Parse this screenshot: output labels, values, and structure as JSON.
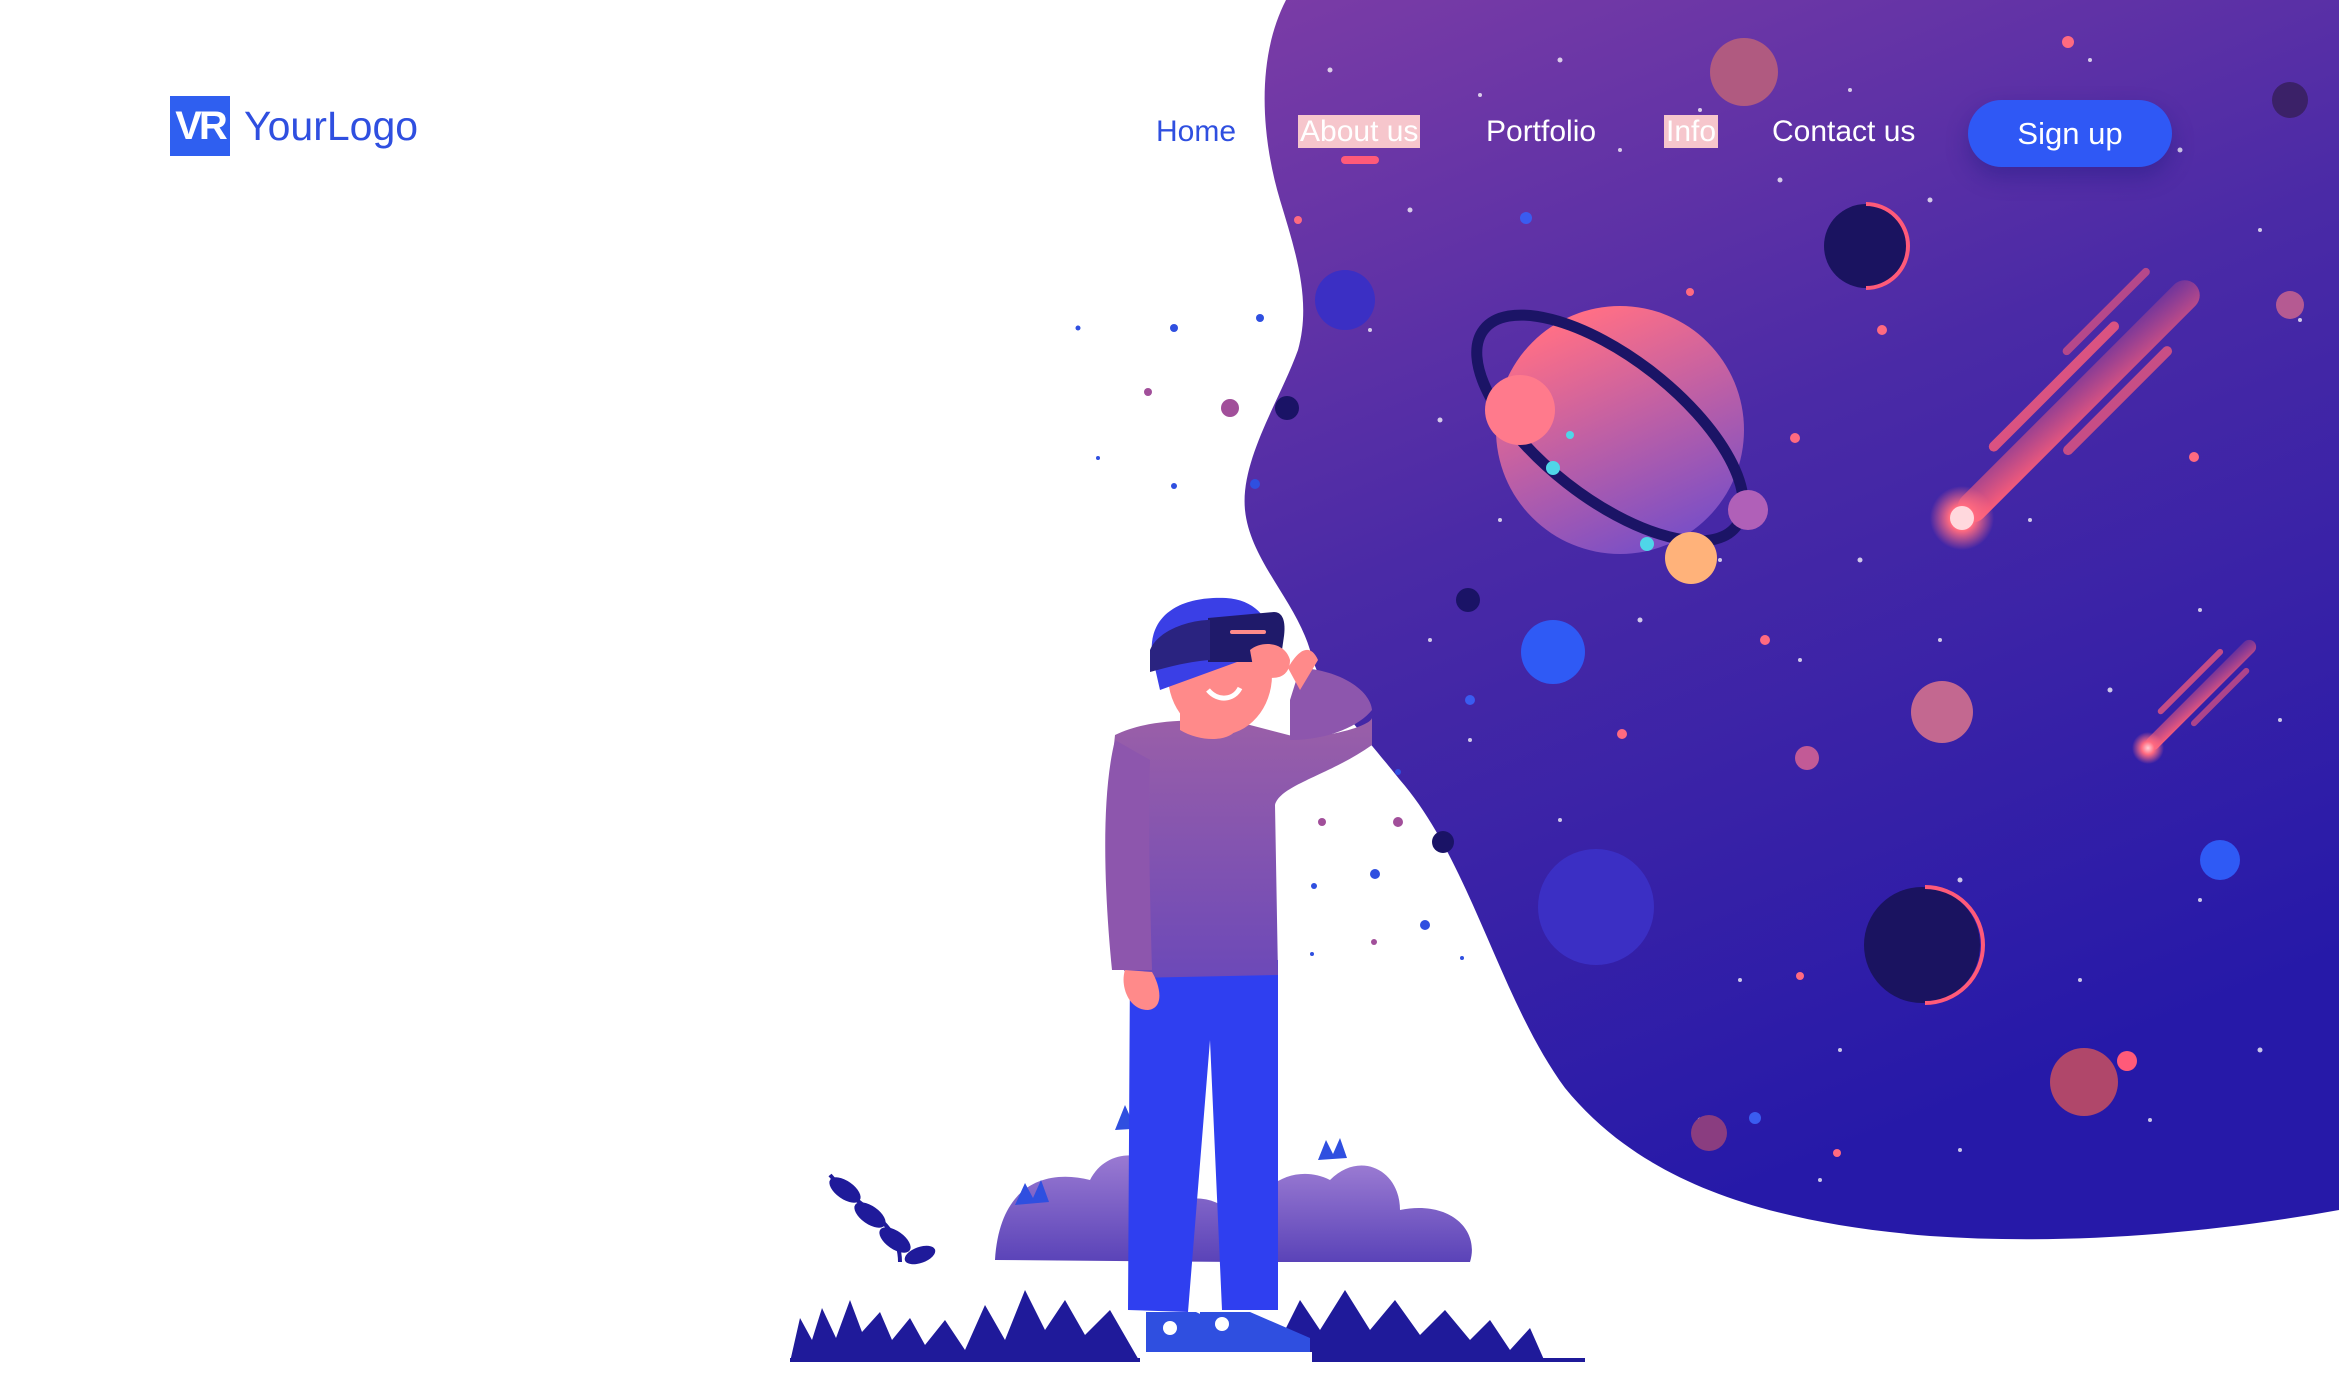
{
  "logo": {
    "mark_text": "VR",
    "name": "YourLogo"
  },
  "nav": {
    "items": [
      {
        "label": "Home"
      },
      {
        "label": "About us"
      },
      {
        "label": "Portfolio"
      },
      {
        "label": "Info"
      },
      {
        "label": "Contact us"
      }
    ],
    "active": "About us",
    "signup_label": "Sign up"
  },
  "colors": {
    "brand_blue": "#2f58f5",
    "space_top": "#7a3aa3",
    "space_bottom": "#2a1aa8",
    "accent_pink": "#ff5a79",
    "underline": "#ff5a79"
  },
  "icons": [
    "vr-headset-person",
    "ringed-planet",
    "comet",
    "planet",
    "star",
    "plant"
  ]
}
